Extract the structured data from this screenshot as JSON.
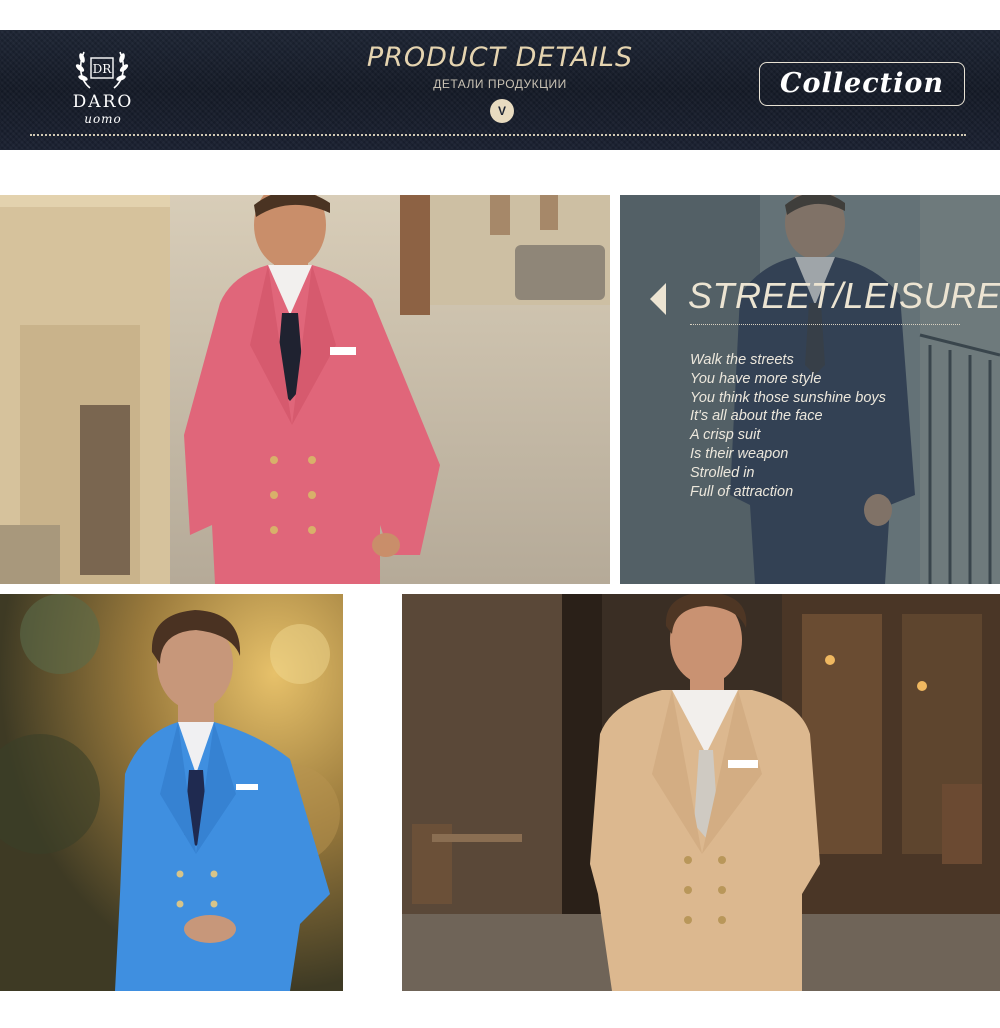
{
  "header": {
    "brand_name": "DARO",
    "brand_sub": "uomo",
    "brand_monogram": "DR",
    "title": "PRODUCT DETAILS",
    "subtitle": "ДЕТАЛИ ПРОДУКЦИИ",
    "badge": "V",
    "collection_button": "Collection"
  },
  "street_panel": {
    "title": "STREET/LEISURE",
    "lines": [
      "Walk the streets",
      "You have more style",
      "You think those sunshine boys",
      "It's all about the face",
      "A crisp suit",
      "Is their weapon",
      "Strolled in",
      "Full of attraction"
    ]
  },
  "photos": [
    {
      "name": "pink-suit",
      "suit_color": "#e0667a"
    },
    {
      "name": "navy-suit",
      "suit_color": "#24324f"
    },
    {
      "name": "blue-suit",
      "suit_color": "#3f8fe0"
    },
    {
      "name": "beige-suit",
      "suit_color": "#dcb88f"
    }
  ],
  "colors": {
    "banner_bg": "#1d2433",
    "gold_text": "#e5d4b0",
    "panel_text": "#ece4d2"
  }
}
